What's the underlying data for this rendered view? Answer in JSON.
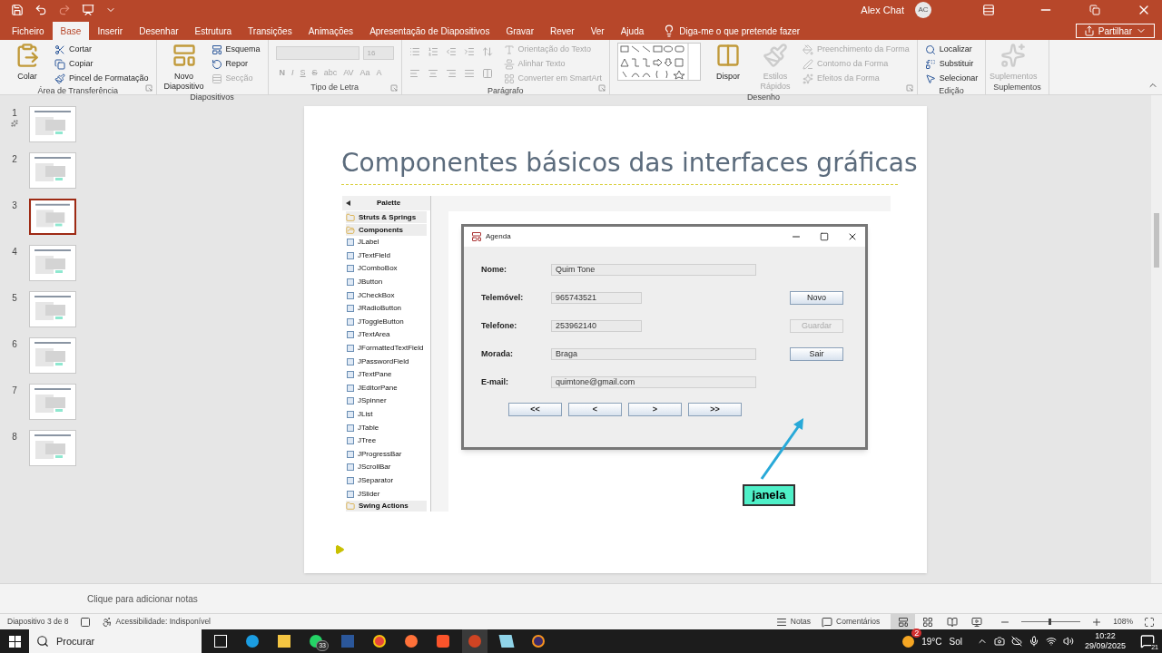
{
  "title_bar": {
    "user": "Alex Chat",
    "avatar": "AC"
  },
  "menu_tabs": [
    {
      "label": "Ficheiro",
      "selected": false
    },
    {
      "label": "Base",
      "selected": true
    },
    {
      "label": "Inserir",
      "selected": false
    },
    {
      "label": "Desenhar",
      "selected": false
    },
    {
      "label": "Estrutura",
      "selected": false
    },
    {
      "label": "Transições",
      "selected": false
    },
    {
      "label": "Animações",
      "selected": false
    },
    {
      "label": "Apresentação de Diapositivos",
      "selected": false
    },
    {
      "label": "Gravar",
      "selected": false
    },
    {
      "label": "Rever",
      "selected": false
    },
    {
      "label": "Ver",
      "selected": false
    },
    {
      "label": "Ajuda",
      "selected": false
    }
  ],
  "tell_me": "Diga-me o que pretende fazer",
  "share": "Partilhar",
  "ribbon": [
    {
      "kind": "standard",
      "title": "Área de Transferência",
      "launcher": true,
      "large": [
        {
          "label": "Colar",
          "disabled": false
        }
      ],
      "small": [
        {
          "label": "Cortar",
          "disabled": false
        },
        {
          "label": "Copiar",
          "disabled": false
        },
        {
          "label": "Pincel de Formatação",
          "disabled": false
        }
      ]
    },
    {
      "kind": "standard",
      "title": "Diapositivos",
      "launcher": false,
      "large": [
        {
          "label": "Novo Diapositivo",
          "disabled": false
        }
      ],
      "small": [
        {
          "label": "Esquema",
          "disabled": false
        },
        {
          "label": "Repor",
          "disabled": false
        },
        {
          "label": "Secção",
          "disabled": true
        }
      ]
    },
    {
      "kind": "font",
      "title": "Tipo de Letra",
      "launcher": true,
      "font_size": "16",
      "format_buttons": [
        "N",
        "I",
        "S",
        "S",
        "abc",
        "AV",
        "Aa",
        "A"
      ]
    },
    {
      "kind": "paragraph",
      "title": "Parágrafo",
      "launcher": true,
      "small": [
        {
          "label": "Orientação do Texto",
          "disabled": true
        },
        {
          "label": "Alinhar Texto",
          "disabled": true
        },
        {
          "label": "Converter em SmartArt",
          "disabled": true
        }
      ]
    },
    {
      "kind": "drawing",
      "title": "Desenho",
      "launcher": true,
      "large": [
        {
          "label": "Dispor",
          "disabled": false
        },
        {
          "label": "Estilos Rápidos",
          "disabled": true
        }
      ],
      "small": [
        {
          "label": "Preenchimento da Forma",
          "disabled": true
        },
        {
          "label": "Contorno da Forma",
          "disabled": true
        },
        {
          "label": "Efeitos da Forma",
          "disabled": true
        }
      ]
    },
    {
      "kind": "standard",
      "title": "Edição",
      "launcher": false,
      "small": [
        {
          "label": "Localizar",
          "disabled": false
        },
        {
          "label": "Substituir",
          "disabled": false
        },
        {
          "label": "Selecionar",
          "disabled": false
        }
      ]
    },
    {
      "kind": "standard",
      "title": "Suplementos",
      "launcher": false,
      "large": [
        {
          "label": "Suplementos",
          "disabled": true
        }
      ]
    }
  ],
  "thumbnails": [
    {
      "number": "1",
      "selected": false,
      "animated": true
    },
    {
      "number": "2",
      "selected": false,
      "animated": false
    },
    {
      "number": "3",
      "selected": true,
      "animated": false
    },
    {
      "number": "4",
      "selected": false,
      "animated": false
    },
    {
      "number": "5",
      "selected": false,
      "animated": false
    },
    {
      "number": "6",
      "selected": false,
      "animated": false
    },
    {
      "number": "7",
      "selected": false,
      "animated": false
    },
    {
      "number": "8",
      "selected": false,
      "animated": false
    }
  ],
  "slide": {
    "title": "Componentes básicos das interfaces gráficas",
    "palette": {
      "title": "Palette",
      "folders": [
        {
          "label": "Struts & Springs",
          "expanded": false
        },
        {
          "label": "Components",
          "expanded": true
        }
      ],
      "items": [
        "JLabel",
        "JTextField",
        "JComboBox",
        "JButton",
        "JCheckBox",
        "JRadioButton",
        "JToggleButton",
        "JTextArea",
        "JFormattedTextField",
        "JPasswordField",
        "JTextPane",
        "JEditorPane",
        "JSpinner",
        "JList",
        "JTable",
        "JTree",
        "JProgressBar",
        "JScrollBar",
        "JSeparator",
        "JSlider"
      ],
      "last_folder": "Swing Actions"
    },
    "window": {
      "title": "Agenda",
      "fields": [
        {
          "label": "Nome:",
          "value": "Quim Tone",
          "kind": "long"
        },
        {
          "label": "Telemóvel:",
          "value": "965743521",
          "kind": "short"
        },
        {
          "label": "Telefone:",
          "value": "253962140",
          "kind": "short"
        },
        {
          "label": "Morada:",
          "value": "Braga",
          "kind": "long"
        },
        {
          "label": "E-mail:",
          "value": "quimtone@gmail.com",
          "kind": "long"
        }
      ],
      "side_buttons": [
        {
          "label": "Novo",
          "disabled": false
        },
        {
          "label": "Guardar",
          "disabled": true
        },
        {
          "label": "Sair",
          "disabled": false
        }
      ],
      "nav_buttons": [
        "<<",
        "<",
        ">",
        ">>"
      ]
    },
    "callout": "janela"
  },
  "notes_placeholder": "Clique para adicionar notas",
  "status_bar": {
    "slide_info": "Diapositivo 3 de 8",
    "accessibility": "Acessibilidade: Indisponível",
    "notes": "Notas",
    "comments": "Comentários",
    "views": [
      {
        "kind": "normal",
        "selected": true
      },
      {
        "kind": "sorter",
        "selected": false
      },
      {
        "kind": "reading",
        "selected": false
      },
      {
        "kind": "show",
        "selected": false
      }
    ],
    "zoom": {
      "level": 0.46
    },
    "zoom_text": "108%"
  },
  "taskbar": {
    "search": "Procurar",
    "apps": [
      {
        "kind": "taskview",
        "active": false
      },
      {
        "kind": "edge",
        "active": false
      },
      {
        "kind": "explorer",
        "active": false
      },
      {
        "kind": "whatsapp",
        "badge": "33",
        "active": false
      },
      {
        "kind": "word",
        "active": false
      },
      {
        "kind": "chrome",
        "active": false
      },
      {
        "kind": "firefox",
        "active": false
      },
      {
        "kind": "brave",
        "active": false
      },
      {
        "kind": "powerpoint",
        "active": true
      },
      {
        "kind": "notes",
        "active": false
      },
      {
        "kind": "eclipse",
        "active": false
      }
    ],
    "weather_badge": "2",
    "temperature": "19°C",
    "weather": "Sol",
    "time": "10:22",
    "date": "29/09/2025",
    "notifications": "21"
  }
}
